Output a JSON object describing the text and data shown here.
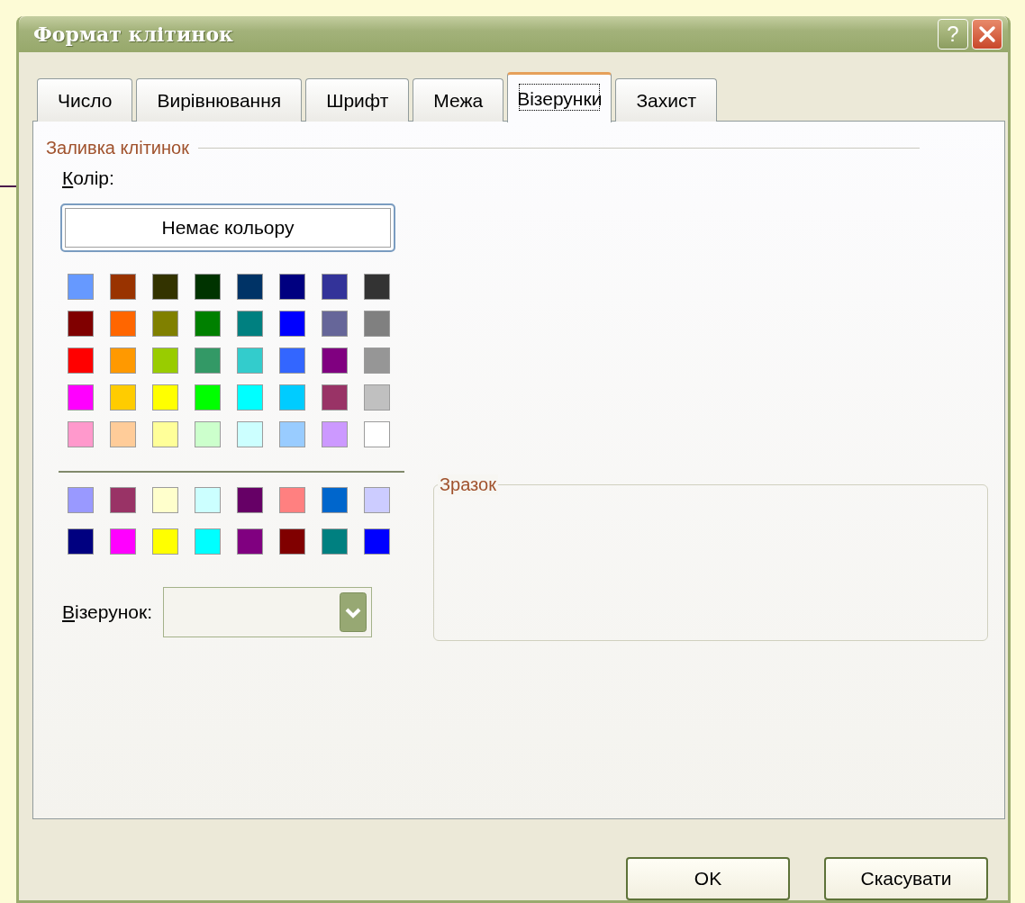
{
  "window": {
    "title": "Формат клітинок",
    "help_button": "?"
  },
  "tabs": [
    {
      "label": "Число",
      "selected": false
    },
    {
      "label": "Вирівнювання",
      "selected": false
    },
    {
      "label": "Шрифт",
      "selected": false
    },
    {
      "label": "Межа",
      "selected": false
    },
    {
      "label": "Візерунки",
      "selected": true
    },
    {
      "label": "Захист",
      "selected": false
    }
  ],
  "fill_group": {
    "title": "Заливка клітинок",
    "color_label": "Колір:",
    "no_color_button": "Немає кольору",
    "palette": [
      {
        "color": "#6699ff"
      },
      {
        "color": "#993300"
      },
      {
        "color": "#333300"
      },
      {
        "color": "#003300"
      },
      {
        "color": "#003366"
      },
      {
        "color": "#000080"
      },
      {
        "color": "#333399"
      },
      {
        "color": "#333333"
      },
      {
        "color": "#800000"
      },
      {
        "color": "#ff6600"
      },
      {
        "color": "#808000"
      },
      {
        "color": "#008000"
      },
      {
        "color": "#008080"
      },
      {
        "color": "#0000ff"
      },
      {
        "color": "#666699"
      },
      {
        "color": "#808080"
      },
      {
        "color": "#ff0000"
      },
      {
        "color": "#ff9900"
      },
      {
        "color": "#99cc00"
      },
      {
        "color": "#339966"
      },
      {
        "color": "#33cccc"
      },
      {
        "color": "#3366ff"
      },
      {
        "color": "#800080"
      },
      {
        "color": "#969696"
      },
      {
        "color": "#ff00ff"
      },
      {
        "color": "#ffcc00"
      },
      {
        "color": "#ffff00"
      },
      {
        "color": "#00ff00"
      },
      {
        "color": "#00ffff"
      },
      {
        "color": "#00ccff"
      },
      {
        "color": "#993366"
      },
      {
        "color": "#c0c0c0"
      },
      {
        "color": "#ff99cc"
      },
      {
        "color": "#ffcc99"
      },
      {
        "color": "#ffff99"
      },
      {
        "color": "#ccffcc"
      },
      {
        "color": "#ccffff"
      },
      {
        "color": "#99ccff"
      },
      {
        "color": "#cc99ff"
      },
      {
        "color": "#ffffff"
      }
    ],
    "extra_palette": [
      {
        "color": "#9999ff"
      },
      {
        "color": "#993366"
      },
      {
        "color": "#ffffcc"
      },
      {
        "color": "#ccffff"
      },
      {
        "color": "#660066"
      },
      {
        "color": "#ff8080"
      },
      {
        "color": "#0066cc"
      },
      {
        "color": "#ccccff"
      },
      {
        "color": "#000080"
      },
      {
        "color": "#ff00ff"
      },
      {
        "color": "#ffff00"
      },
      {
        "color": "#00ffff"
      },
      {
        "color": "#800080"
      },
      {
        "color": "#800000"
      },
      {
        "color": "#008080"
      },
      {
        "color": "#0000ff"
      }
    ],
    "pattern_label": "Візерунок:"
  },
  "sample_group": {
    "title": "Зразок"
  },
  "buttons": [
    {
      "label": "OK"
    },
    {
      "label": "Скасувати"
    }
  ]
}
